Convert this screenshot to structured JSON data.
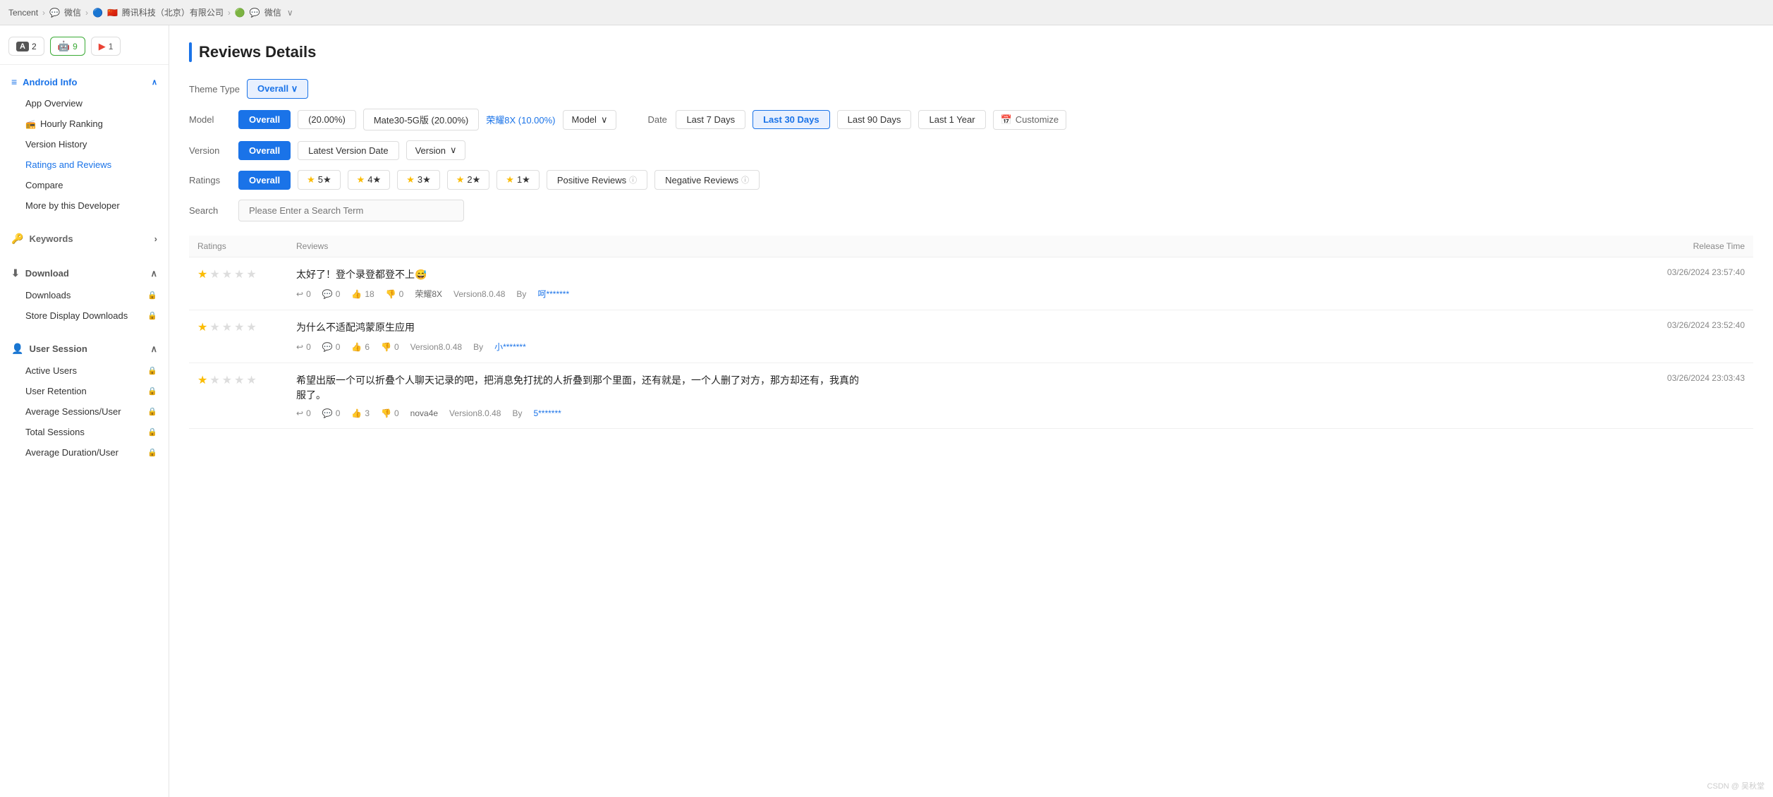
{
  "topbar": {
    "company": "Tencent",
    "breadcrumbs": [
      "微信",
      "腾讯科技（北京）有限公司",
      "微信"
    ],
    "icons": [
      "🖥",
      "💬",
      "🔵",
      "🇨🇳",
      "🟢",
      "💬"
    ]
  },
  "sidebar": {
    "badges": [
      {
        "label": "2",
        "type": "ios",
        "icon": "A"
      },
      {
        "label": "9",
        "type": "android",
        "icon": "🤖"
      },
      {
        "label": "1",
        "type": "gplay",
        "icon": "▶"
      }
    ],
    "nav": [
      {
        "group": "Android Info",
        "icon": "☰",
        "expanded": true,
        "items": [
          {
            "label": "App Overview",
            "lock": false,
            "active": false
          },
          {
            "label": "Hourly Ranking",
            "lock": false,
            "active": false,
            "special": true
          },
          {
            "label": "Version History",
            "lock": false,
            "active": false
          },
          {
            "label": "Ratings and Reviews",
            "lock": false,
            "active": true
          },
          {
            "label": "Compare",
            "lock": false,
            "active": false
          },
          {
            "label": "More by this Developer",
            "lock": false,
            "active": false
          }
        ]
      },
      {
        "group": "Keywords",
        "icon": "🔑",
        "expanded": false,
        "items": []
      },
      {
        "group": "Download",
        "icon": "⬇",
        "expanded": true,
        "items": [
          {
            "label": "Downloads",
            "lock": true,
            "active": false
          },
          {
            "label": "Store Display Downloads",
            "lock": true,
            "active": false
          }
        ]
      },
      {
        "group": "User Session",
        "icon": "👤",
        "expanded": true,
        "items": [
          {
            "label": "Active Users",
            "lock": true,
            "active": false
          },
          {
            "label": "User Retention",
            "lock": true,
            "active": false
          },
          {
            "label": "Average Sessions/User",
            "lock": true,
            "active": false
          },
          {
            "label": "Total Sessions",
            "lock": true,
            "active": false
          },
          {
            "label": "Average Duration/User",
            "lock": true,
            "active": false
          }
        ]
      }
    ]
  },
  "main": {
    "title": "Reviews Details",
    "theme_type_label": "Theme Type",
    "theme_type_value": "Overall",
    "filters": {
      "model_label": "Model",
      "model_options": [
        {
          "label": "Overall",
          "active": true
        },
        {
          "label": "(20.00%)",
          "active": false
        },
        {
          "label": "Mate30-5G版 (20.00%)",
          "active": false
        },
        {
          "label": "荣耀8X (10.00%)",
          "active": false,
          "link": true
        }
      ],
      "model_dropdown": "Model",
      "date_label": "Date",
      "date_options": [
        {
          "label": "Last 7 Days",
          "active": false
        },
        {
          "label": "Last 30 Days",
          "active": true
        },
        {
          "label": "Last 90 Days",
          "active": false
        },
        {
          "label": "Last 1 Year",
          "active": false
        }
      ],
      "customize_label": "Customize",
      "version_label": "Version",
      "version_options": [
        {
          "label": "Overall",
          "active": true
        },
        {
          "label": "Latest Version Date",
          "active": false
        }
      ],
      "version_dropdown": "Version",
      "ratings_label": "Ratings",
      "ratings_options": [
        {
          "label": "Overall",
          "active": true
        },
        {
          "label": "5★",
          "stars": 5,
          "active": false
        },
        {
          "label": "4★",
          "stars": 4,
          "active": false
        },
        {
          "label": "3★",
          "stars": 3,
          "active": false
        },
        {
          "label": "2★",
          "stars": 2,
          "active": false
        },
        {
          "label": "1★",
          "stars": 1,
          "active": false
        }
      ],
      "positive_reviews": "Positive Reviews",
      "negative_reviews": "Negative Reviews"
    },
    "search_placeholder": "Please Enter a Search Term",
    "table": {
      "columns": [
        "Ratings",
        "Reviews",
        "Release Time"
      ],
      "rows": [
        {
          "stars": 1,
          "review_text": "太好了！登个录登都登不上😅",
          "reply": "0",
          "comment": "0",
          "likes": "18",
          "dislikes": "0",
          "device": "荣耀8X",
          "version": "Version8.0.48",
          "author": "呵*******",
          "release_time": "03/26/2024 23:57:40"
        },
        {
          "stars": 1,
          "review_text": "为什么不适配鸿蒙原生应用",
          "reply": "0",
          "comment": "0",
          "likes": "6",
          "dislikes": "0",
          "device": "",
          "version": "Version8.0.48",
          "author": "小*******",
          "release_time": "03/26/2024 23:52:40"
        },
        {
          "stars": 1,
          "review_text": "希望出版一个可以折叠个人聊天记录的吧，把消息免打扰的人折叠到那个里面，还有就是，一个人删了对方，那方却还有，我真的服了。",
          "reply": "0",
          "comment": "0",
          "likes": "3",
          "dislikes": "0",
          "device": "nova4e",
          "version": "Version8.0.48",
          "author": "5*******",
          "release_time": "03/26/2024 23:03:43"
        }
      ]
    }
  },
  "watermark": "CSDN @ 吴秋堂"
}
